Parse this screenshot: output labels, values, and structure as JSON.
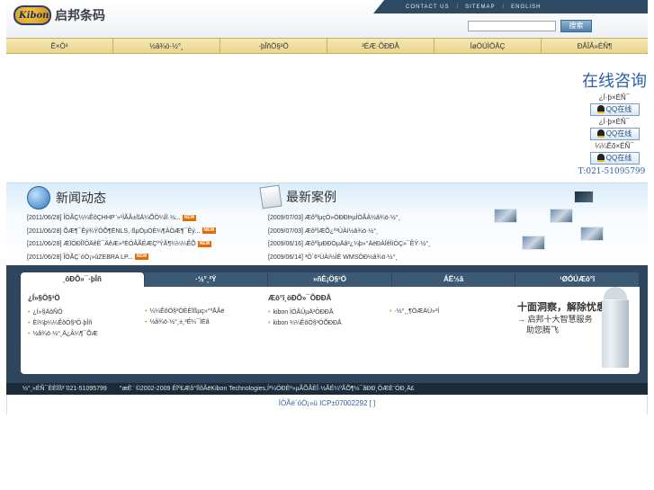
{
  "header": {
    "logo_mark": "Kibon",
    "logo_text": "启邦条码",
    "top_links": [
      "CONTACT US",
      "SITEMAP",
      "ENGLISH"
    ],
    "top_sep": "/",
    "search_button": "搜索"
  },
  "nav": {
    "items": [
      "Ê×Ò³",
      "½â¾ö·½°¸",
      "·þÎñÖ§³Ö",
      "³ÉÆ·ÕÐÐÅ",
      "ÍøÓÚÌÖÂÇ",
      "ÐÂÎÅ»ÉÑ¶"
    ]
  },
  "chat": {
    "title": "在线咨询",
    "label": "¿Í·þ×ÉÑ¯",
    "label2": "¼¼Êõ×ÉÑ¯",
    "qq_label": "QQ在线",
    "phone": "T:021-51095799"
  },
  "news": {
    "title": "新闻动态",
    "badge": "NEW",
    "items": [
      {
        "date": "[2011/06/28]",
        "text": "ÎÒÃÇ¼¼ÊõÇHHP¨»¹ÌÃÂ±ßÄ¼ÕÖ¼ÍÏ·½..."
      },
      {
        "date": "[2011/06/28]",
        "text": "ÕÆ¶¯Êý¾ÝÖÕ¶ËNLS,·ßµÓµÓÈ¼¶ÀÖÆ¶¯Êý..."
      },
      {
        "date": "[2011/06/28]",
        "text": "ÆÏÒÐÎÏÔÄêÈ¯ÄêÆ»ºÉÖÂÃÉÆÇºÝÂ¶¼¼¼ÊÕ"
      },
      {
        "date": "[2011/06/28]",
        "text": "ÎÒÃÇ´óÒ¡»ûZEBRA LP..."
      }
    ]
  },
  "cases": {
    "title": "最新案例",
    "items": [
      {
        "date": "[2009/07/03]",
        "text": "ÆôºîµçÓ»ÓÐÐÞµÍÒÃÁ½â¾ö·½°¸"
      },
      {
        "date": "[2009/07/03]",
        "text": "ÆôºîÆÕ¿ª³ÛÀí½â¾ö·½°¸"
      },
      {
        "date": "[2009/06/16]",
        "text": "ÆôºîµÐÐÓµÄâ²¿¼þ»°ÄèÐÀÍêÌìÖÇ»¯ÊÝ·½°¸"
      },
      {
        "date": "[2009/06/14]",
        "text": "³Ö´¢¹ÜÀí½ÌÈ WMSÖÐ½â¾ö·½°¸"
      }
    ]
  },
  "tabs": {
    "labels": [
      "¸ôÐÔ»¯·þÎñ",
      "·½°¸²Ý",
      "»ñÈ¡Ö§³Ö",
      "ÁË½â",
      "¹ØÓÚÆô°î"
    ]
  },
  "panel": {
    "col1_head": "¿Í»§Ö§³Ö",
    "col1_items": [
      "¿Í»§ÁôÑÔ",
      "Èí¼þ¼¼ÊõÖ§³Ö·þÎñ",
      "½â¾ö·½°¸Ä¿Â¼¶¯ÕÆ"
    ],
    "col2_items": [
      "¼¼ÊõÖ§³ÖÈÈÏßµç»°ºÅÂë",
      "½â¾ö·½°¸±¸²É¼¯ÌÈã"
    ],
    "col3_head": "Æô°î¸öÐÔ»¯ÕÐÐÅ",
    "col3_items": [
      "kibon ÌÖÂÛµÄ³ÖÐÐÅ",
      "kibon ¼¼ÊõÖ§³ÖÕÐÐÅ"
    ],
    "col4_items": [
      "·½°¸¸¶ÖÆÄÜ»³Í"
    ],
    "promo_title": "十面洞察，解除忧患",
    "promo_lines": [
      "→ 启邦十大智慧服务",
      "助您腾飞"
    ]
  },
  "footer": {
    "contact": "½°¸»ÉÑ¯ÈÈÏß²¨021-51095799",
    "copyright": "°æÈ¨ ©2002-2009 ÉÏº£Æô°îÌõÂëKibon Technologies,Í³¼ÓÐÈ²»µÃÕÃÈÎ·½ÃÉ¼ºÃÕ¶½¯ãÐÐ¸ÖÆÈ¨ÓÐ¸Ä£"
  },
  "icp": "ÍÒÃé´óÒ¡»ü ICP±07002292 [  ]"
}
